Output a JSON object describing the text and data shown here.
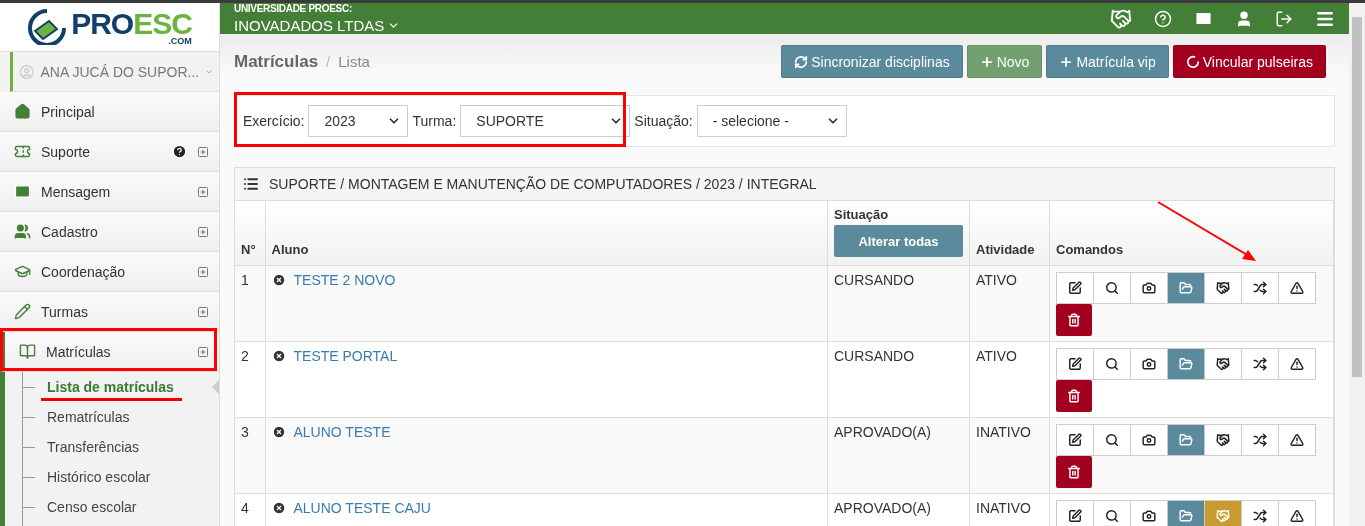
{
  "logo": {
    "main": "PRO",
    "accent": "ESC",
    "domain": ".COM"
  },
  "header": {
    "institution": "UNIVERSIDADE PROESC:",
    "company": "INOVADADOS LTDAS"
  },
  "sidebar": {
    "user": "ANA JUCÁ DO SUPOR...",
    "items": [
      {
        "label": "Principal",
        "expandable": false,
        "help": false,
        "selected": false
      },
      {
        "label": "Suporte",
        "expandable": true,
        "help": true,
        "selected": false
      },
      {
        "label": "Mensagem",
        "expandable": true,
        "help": false,
        "selected": false
      },
      {
        "label": "Cadastro",
        "expandable": true,
        "help": false,
        "selected": false
      },
      {
        "label": "Coordenação",
        "expandable": true,
        "help": false,
        "selected": false
      },
      {
        "label": "Turmas",
        "expandable": true,
        "help": false,
        "selected": false
      },
      {
        "label": "Matrículas",
        "expandable": true,
        "help": false,
        "selected": true,
        "children": [
          {
            "label": "Lista de matrículas",
            "selected": true
          },
          {
            "label": "Rematrículas",
            "selected": false
          },
          {
            "label": "Transferências",
            "selected": false
          },
          {
            "label": "Histórico escolar",
            "selected": false
          },
          {
            "label": "Censo escolar",
            "selected": false
          }
        ]
      }
    ]
  },
  "breadcrumb": {
    "title": "Matrículas",
    "separator": "/",
    "current": "Lista"
  },
  "actions": [
    {
      "label": "Sincronizar disciplinas",
      "kind": "sync"
    },
    {
      "label": "Novo",
      "kind": "new"
    },
    {
      "label": "Matrícula vip",
      "kind": "vip"
    },
    {
      "label": "Vincular pulseiras",
      "kind": "link"
    }
  ],
  "filters": [
    {
      "label": "Exercício:",
      "value": "2023"
    },
    {
      "label": "Turma:",
      "value": "SUPORTE"
    },
    {
      "label": "Situação:",
      "value": "- selecione -"
    }
  ],
  "table": {
    "title": "SUPORTE / MONTAGEM E MANUTENÇÃO DE COMPUTADORES / 2023 / INTEGRAL",
    "columns": [
      "N°",
      "Aluno",
      "Situação",
      "Atividade",
      "Comandos"
    ],
    "bulk_button": "Alterar todas",
    "rows": [
      {
        "number": "1",
        "name": "TESTE 2 NOVO",
        "status": "CURSANDO",
        "activity": "ATIVO",
        "commands": [
          {
            "kind": "edit",
            "active": false
          },
          {
            "kind": "search",
            "active": false
          },
          {
            "kind": "camera",
            "active": false
          },
          {
            "kind": "folder",
            "active": false
          },
          {
            "kind": "handshake",
            "active": false
          },
          {
            "kind": "shuffle",
            "active": false
          },
          {
            "kind": "warning",
            "active": false
          },
          {
            "kind": "delete",
            "active": false
          }
        ]
      },
      {
        "number": "2",
        "name": "TESTE PORTAL",
        "status": "CURSANDO",
        "activity": "ATIVO",
        "commands": [
          {
            "kind": "edit",
            "active": false
          },
          {
            "kind": "search",
            "active": false
          },
          {
            "kind": "camera",
            "active": false
          },
          {
            "kind": "folder",
            "active": false
          },
          {
            "kind": "handshake",
            "active": false
          },
          {
            "kind": "shuffle",
            "active": false
          },
          {
            "kind": "warning",
            "active": false
          },
          {
            "kind": "delete",
            "active": false
          }
        ]
      },
      {
        "number": "3",
        "name": "ALUNO TESTE",
        "status": "APROVADO(A)",
        "activity": "INATIVO",
        "commands": [
          {
            "kind": "edit",
            "active": false
          },
          {
            "kind": "search",
            "active": false
          },
          {
            "kind": "camera",
            "active": false
          },
          {
            "kind": "folder",
            "active": false
          },
          {
            "kind": "handshake",
            "active": false
          },
          {
            "kind": "shuffle",
            "active": false
          },
          {
            "kind": "warning",
            "active": false
          },
          {
            "kind": "delete",
            "active": false
          }
        ]
      },
      {
        "number": "4",
        "name": "ALUNO TESTE CAJU",
        "status": "APROVADO(A)",
        "activity": "INATIVO",
        "commands": [
          {
            "kind": "edit",
            "active": false
          },
          {
            "kind": "search",
            "active": false
          },
          {
            "kind": "camera",
            "active": false
          },
          {
            "kind": "folder",
            "active": false
          },
          {
            "kind": "handshake",
            "active": true
          },
          {
            "kind": "shuffle",
            "active": false
          },
          {
            "kind": "warning",
            "active": false
          }
        ]
      }
    ]
  }
}
